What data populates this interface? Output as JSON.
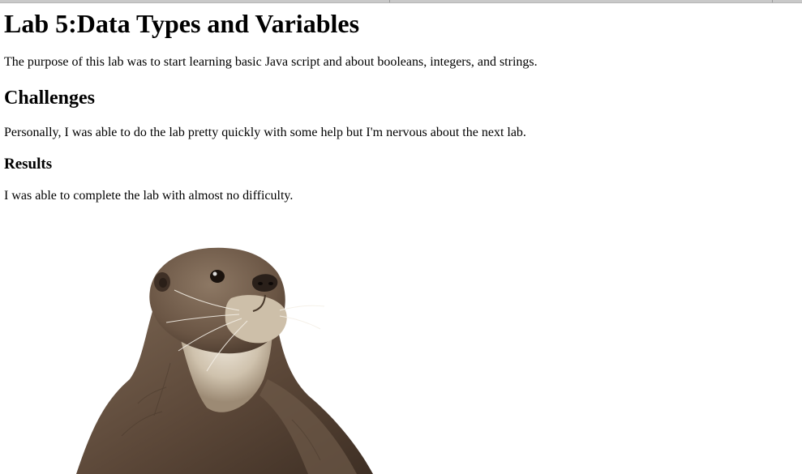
{
  "page": {
    "title": "Lab 5:Data Types and Variables",
    "purpose": "The purpose of this lab was to start learning basic Java script and about booleans, integers, and strings.",
    "challenges_heading": "Challenges",
    "challenges_text": "Personally, I was able to do the lab pretty quickly with some help but I'm nervous about the next lab.",
    "results_heading": "Results",
    "results_text": "I was able to complete the lab with almost no difficulty."
  },
  "image": {
    "subject": "otter-photo",
    "colors": {
      "fur_dark": "#4a3a2c",
      "fur_mid": "#7a6552",
      "fur_light": "#a89682",
      "cream": "#e8e0d0",
      "nose": "#2a201a"
    }
  }
}
